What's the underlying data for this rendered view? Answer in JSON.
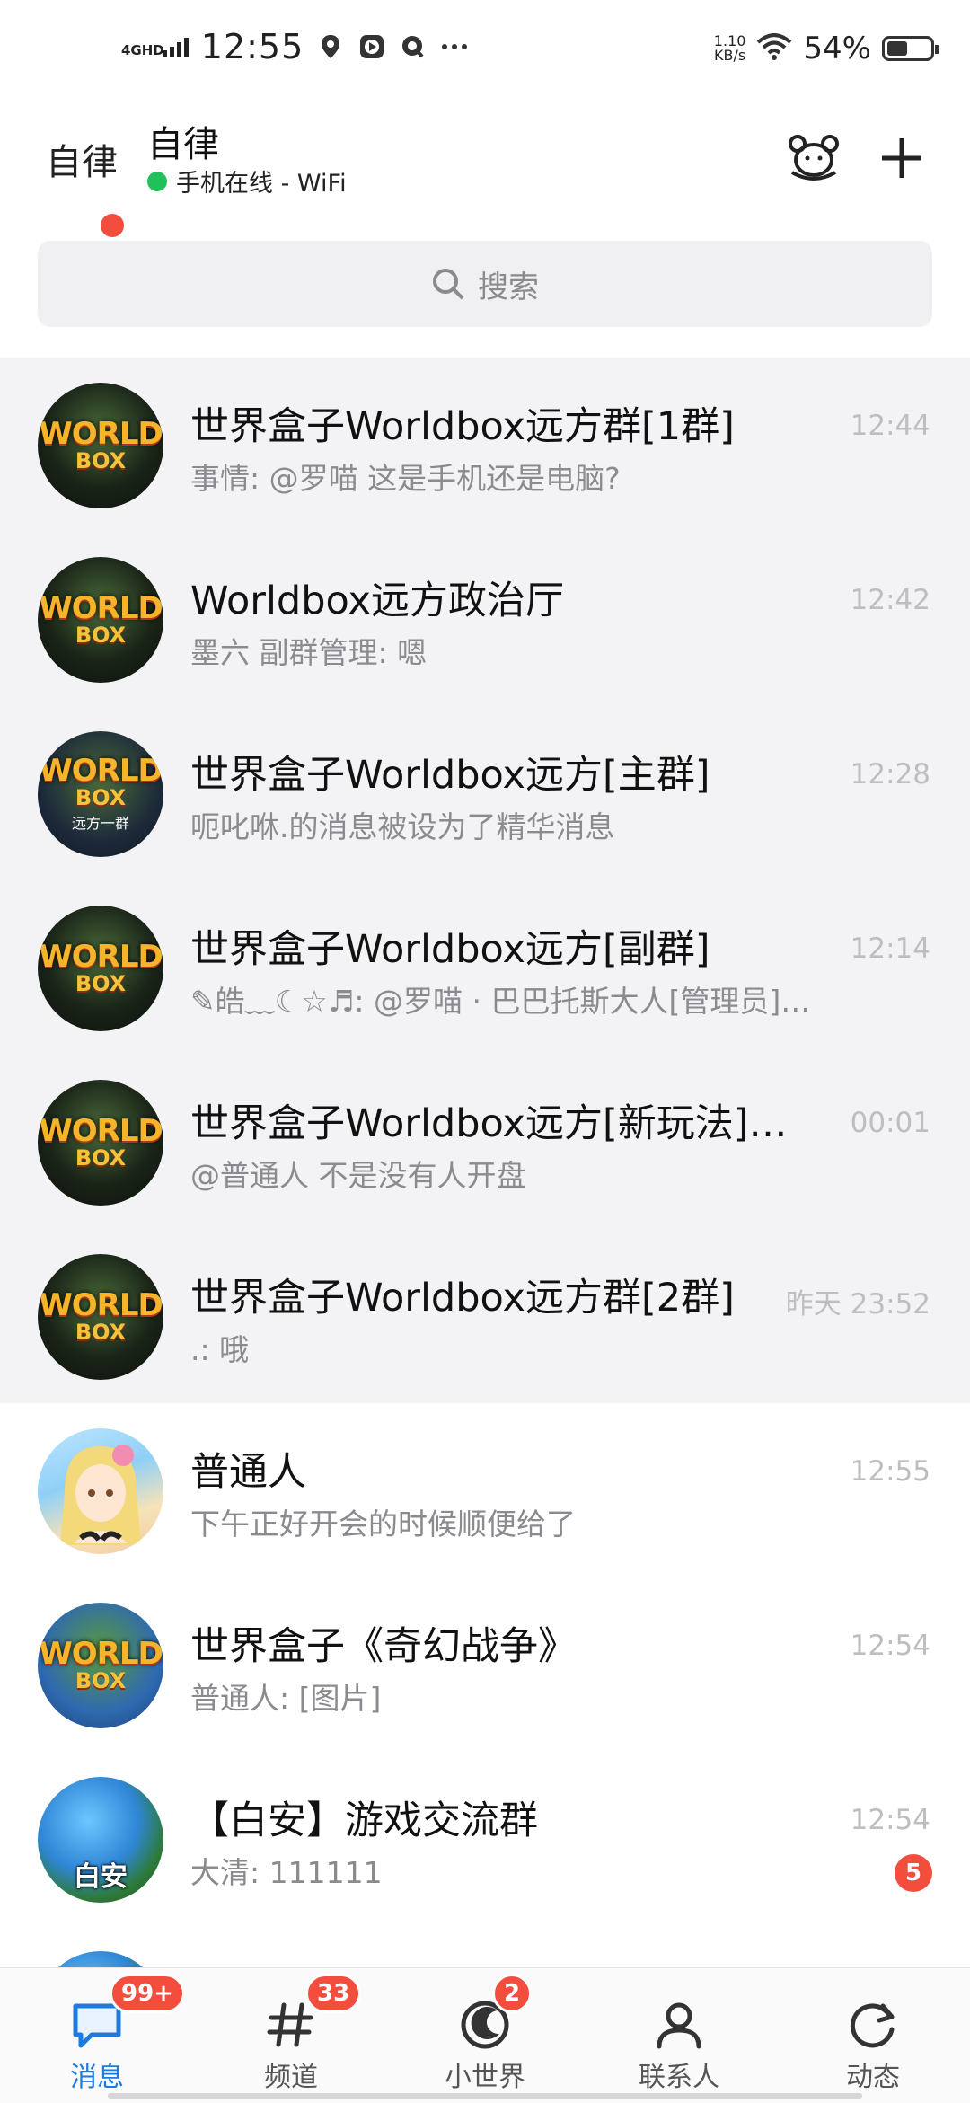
{
  "status_bar": {
    "network": "4GHD",
    "time": "12:55",
    "speed_value": "1.10",
    "speed_unit": "KB/s",
    "battery": "54%",
    "battery_level": 0.54
  },
  "header": {
    "avatar_text": "自律",
    "name": "自律",
    "status": "手机在线 - WiFi"
  },
  "search": {
    "placeholder": "搜索"
  },
  "chats": [
    {
      "title": "世界盒子Worldbox远方群[1群]",
      "message": "事情: @罗喵 这是手机还是电脑?",
      "time": "12:44",
      "pinned": true,
      "avatar": "worldbox"
    },
    {
      "title": "Worldbox远方政治厅",
      "message": "墨六 副群管理: 嗯",
      "time": "12:42",
      "pinned": true,
      "avatar": "worldbox"
    },
    {
      "title": "世界盒子Worldbox远方[主群]",
      "message": "呃叱咻.的消息被设为了精华消息",
      "time": "12:28",
      "pinned": true,
      "avatar": "worldbox-blue",
      "avatar_caption": "远方一群"
    },
    {
      "title": "世界盒子Worldbox远方[副群]",
      "message": "✎皓﹏☾☆♬: @罗喵 · 巴巴托斯大人[管理员]…",
      "time": "12:14",
      "pinned": true,
      "avatar": "worldbox"
    },
    {
      "title": "世界盒子Worldbox远方[新玩法]…",
      "message": "@普通人 不是没有人开盘",
      "time": "00:01",
      "pinned": true,
      "avatar": "worldbox"
    },
    {
      "title": "世界盒子Worldbox远方群[2群]",
      "message": ".: 哦",
      "time": "昨天 23:52",
      "pinned": true,
      "avatar": "worldbox"
    },
    {
      "title": "普通人",
      "message": "下午正好开会的时候顺便给了",
      "time": "12:55",
      "pinned": false,
      "avatar": "anime"
    },
    {
      "title": "世界盒子《奇幻战争》",
      "message": "普通人: [图片]",
      "time": "12:54",
      "pinned": false,
      "avatar": "worldbox-sky"
    },
    {
      "title": "【白安】游戏交流群",
      "message": "大清: 111111",
      "time": "12:54",
      "pinned": false,
      "avatar": "earth",
      "avatar_caption": "白安",
      "unread": "5"
    }
  ],
  "tabs": [
    {
      "label": "消息",
      "badge": "99+",
      "active": true,
      "icon": "message-icon"
    },
    {
      "label": "频道",
      "badge": "33",
      "active": false,
      "icon": "channel-icon"
    },
    {
      "label": "小世界",
      "badge": "2",
      "active": false,
      "icon": "small-world-icon"
    },
    {
      "label": "联系人",
      "badge": "",
      "active": false,
      "icon": "contacts-icon"
    },
    {
      "label": "动态",
      "badge": "",
      "active": false,
      "icon": "moments-icon"
    }
  ],
  "wb_logo": {
    "line1": "WORLD",
    "line2": "BOX"
  }
}
